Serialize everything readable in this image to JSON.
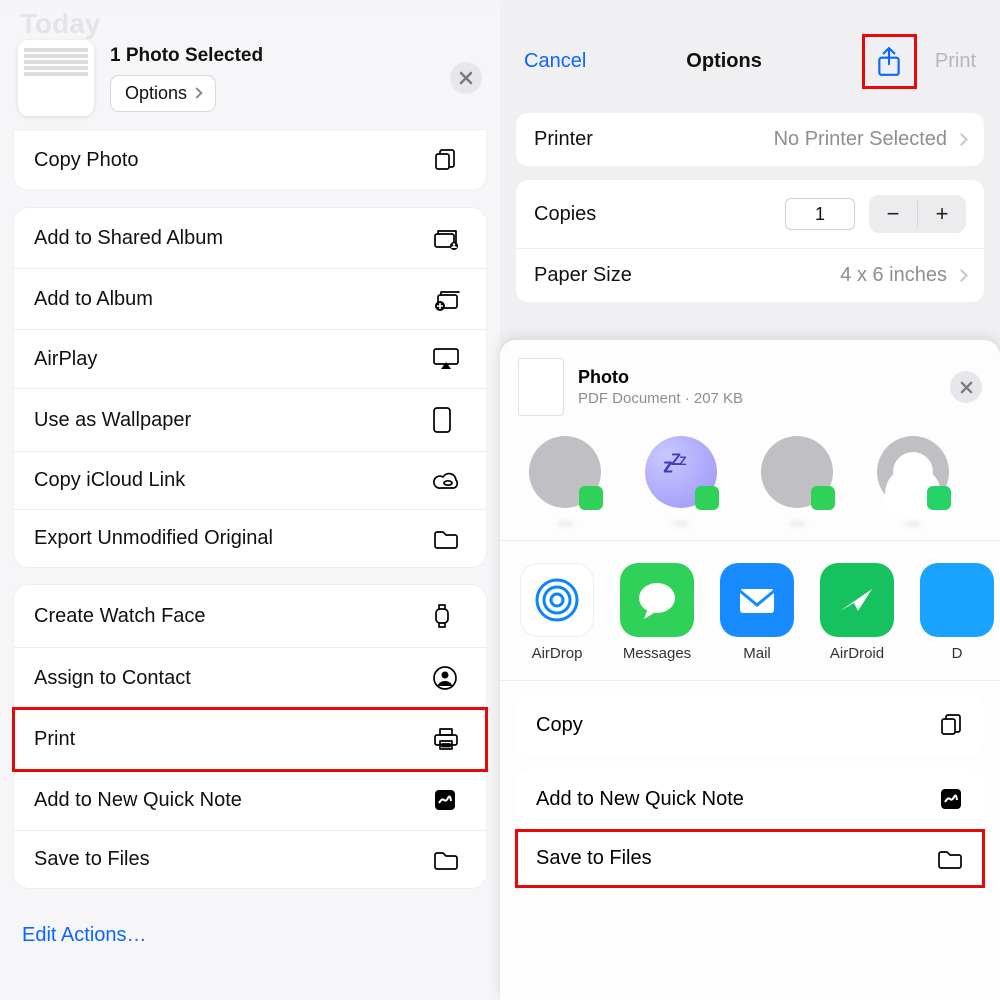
{
  "left": {
    "bg_title": "Today",
    "header": {
      "title": "1 Photo Selected",
      "options_label": "Options"
    },
    "groups": [
      {
        "cut_top": true,
        "rows": [
          {
            "label": "Copy Photo",
            "icon": "copy-icon"
          }
        ]
      },
      {
        "rows": [
          {
            "label": "Add to Shared Album",
            "icon": "shared-album-icon"
          },
          {
            "label": "Add to Album",
            "icon": "add-album-icon"
          },
          {
            "label": "AirPlay",
            "icon": "airplay-icon"
          },
          {
            "label": "Use as Wallpaper",
            "icon": "phone-icon"
          },
          {
            "label": "Copy iCloud Link",
            "icon": "cloud-link-icon"
          },
          {
            "label": "Export Unmodified Original",
            "icon": "folder-icon"
          }
        ]
      },
      {
        "rows": [
          {
            "label": "Create Watch Face",
            "icon": "watch-icon"
          },
          {
            "label": "Assign to Contact",
            "icon": "contact-icon"
          },
          {
            "label": "Print",
            "icon": "print-icon",
            "highlight": true
          },
          {
            "label": "Add to New Quick Note",
            "icon": "quicknote-icon"
          },
          {
            "label": "Save to Files",
            "icon": "folder-icon"
          }
        ]
      }
    ],
    "edit_actions": "Edit Actions…"
  },
  "right": {
    "nav": {
      "cancel": "Cancel",
      "title": "Options",
      "print": "Print"
    },
    "printer": {
      "label": "Printer",
      "value": "No Printer Selected"
    },
    "copies": {
      "label": "Copies",
      "value": "1"
    },
    "paper": {
      "label": "Paper Size",
      "value": "4 x 6 inches"
    },
    "sheet": {
      "title": "Photo",
      "subtitle": "PDF Document · 207 KB",
      "contacts": [
        {
          "name": "—",
          "badge": "msg",
          "style": "gray"
        },
        {
          "name": "—",
          "badge": "msg",
          "style": "zz"
        },
        {
          "name": "—",
          "badge": "msg",
          "style": "gray"
        },
        {
          "name": "—",
          "badge": "wa",
          "style": "person"
        }
      ],
      "apps": [
        {
          "label": "AirDrop",
          "kind": "airdrop"
        },
        {
          "label": "Messages",
          "kind": "messages"
        },
        {
          "label": "Mail",
          "kind": "mail"
        },
        {
          "label": "AirDroid",
          "kind": "airdroid"
        },
        {
          "label": "D",
          "kind": "extra"
        }
      ],
      "actions": [
        [
          {
            "label": "Copy",
            "icon": "copy-icon"
          }
        ],
        [
          {
            "label": "Add to New Quick Note",
            "icon": "quicknote-icon"
          },
          {
            "label": "Save to Files",
            "icon": "folder-icon",
            "highlight": true
          }
        ]
      ]
    }
  }
}
